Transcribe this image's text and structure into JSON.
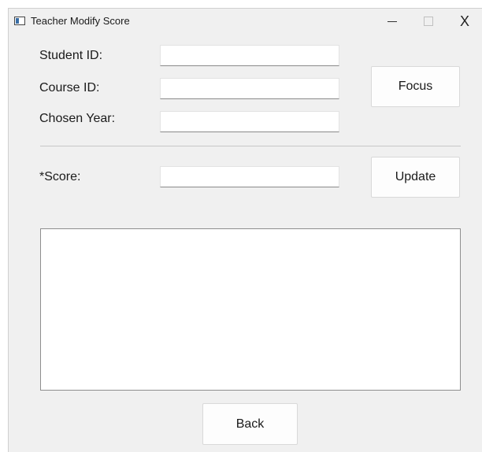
{
  "window": {
    "title": "Teacher Modify Score",
    "minimize_label": "–",
    "maximize_label": "□",
    "close_label": "X"
  },
  "form": {
    "student_id_label": "Student ID:",
    "student_id_value": "",
    "course_id_label": "Course ID:",
    "course_id_value": "",
    "chosen_year_label": "Chosen Year:",
    "chosen_year_value": "",
    "score_label": "*Score:",
    "score_value": ""
  },
  "buttons": {
    "focus_label": "Focus",
    "update_label": "Update",
    "back_label": "Back"
  },
  "output": {
    "text": ""
  }
}
